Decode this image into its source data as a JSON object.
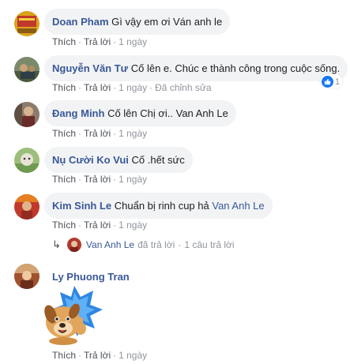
{
  "comments": [
    {
      "author": "Doan Pham",
      "text": "Gì vậy em ơi Ván anh le",
      "actions": {
        "like": "Thích",
        "reply": "Trả lời",
        "time": "1 ngày"
      }
    },
    {
      "author": "Nguyễn Văn Tư",
      "text": "Cố lên e. Chúc e thành công trong cuộc sống.",
      "reaction_count": "1",
      "actions": {
        "like": "Thích",
        "reply": "Trả lời",
        "time": "1 ngày",
        "edited": "Đã chỉnh sửa"
      }
    },
    {
      "author": "Đang Minh",
      "text": "Cố lên Chị ơi.. Van Anh Le",
      "actions": {
        "like": "Thích",
        "reply": "Trả lời",
        "time": "1 ngày"
      }
    },
    {
      "author": "Nụ Cười Ko Vui",
      "text": "Cố .hết sức",
      "actions": {
        "like": "Thích",
        "reply": "Trả lời",
        "time": "1 ngày"
      }
    },
    {
      "author": "Kim Sinh Le",
      "text": "Chuẩn bị rinh cup hả",
      "mention": "Van Anh Le",
      "actions": {
        "like": "Thích",
        "reply": "Trả lời",
        "time": "1 ngày"
      },
      "reply_summary": {
        "name": "Van Anh Le",
        "replied": "đã trả lời",
        "count": "1 câu trả lời"
      }
    },
    {
      "author": "Ly Phuong Tran",
      "sticker": "thumbs-up-dog-sticker",
      "actions": {
        "like": "Thích",
        "reply": "Trả lời",
        "time": "1 ngày"
      }
    }
  ],
  "colors": {
    "link": "#385898",
    "bubble": "#f2f3f5",
    "meta": "#90949c",
    "like_blue": "#1877f2"
  },
  "icons": {
    "reply_arrow": "reply-arrow-icon",
    "like_reaction": "like-reaction-icon"
  }
}
